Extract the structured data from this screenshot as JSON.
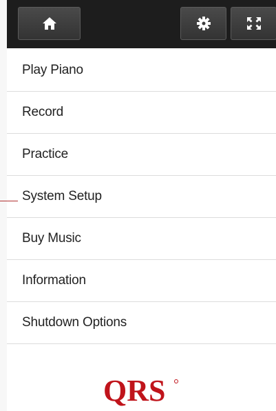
{
  "toolbar": {
    "home_icon": "home-icon",
    "settings_icon": "gear-icon",
    "fullscreen_icon": "expand-icon"
  },
  "menu": {
    "items": [
      {
        "label": "Play Piano"
      },
      {
        "label": "Record"
      },
      {
        "label": "Practice"
      },
      {
        "label": "System Setup"
      },
      {
        "label": "Buy Music"
      },
      {
        "label": "Information"
      },
      {
        "label": "Shutdown Options"
      }
    ]
  },
  "logo": {
    "text": "QRS",
    "color": "#c0141b"
  },
  "colors": {
    "toolbar_bg": "#1d1d1d",
    "button_bg": "#3c3c3c",
    "divider": "#dcdcdc",
    "accent": "#c0141b"
  }
}
